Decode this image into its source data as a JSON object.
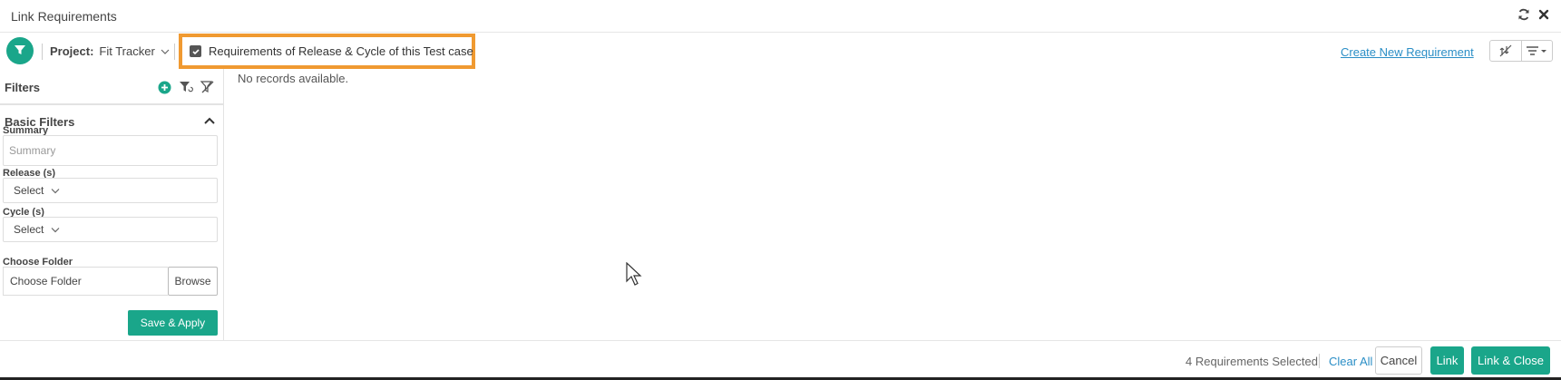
{
  "window": {
    "title": "Link Requirements",
    "refresh_icon": "refresh-icon",
    "close_icon": "close-icon"
  },
  "toolbar": {
    "filter_icon": "filter-icon",
    "project_label": "Project:",
    "project_value": "Fit Tracker",
    "req_checkbox_label": "Requirements of Release & Cycle of this Test case",
    "req_checkbox_checked": true,
    "create_link": "Create New Requirement",
    "highlight_color": "#f09a31"
  },
  "sidebar": {
    "title": "Filters",
    "section_title": "Basic Filters",
    "summary_label": "Summary",
    "summary_placeholder": "Summary",
    "release_label": "Release (s)",
    "release_value": "Select",
    "cycle_label": "Cycle (s)",
    "cycle_value": "Select",
    "folder_label": "Choose Folder",
    "folder_value": "Choose Folder",
    "browse_label": "Browse",
    "save_apply_label": "Save & Apply"
  },
  "main": {
    "empty_message": "No records available."
  },
  "footer": {
    "selected_count": "4 Requirements Selected",
    "clear_all": "Clear All",
    "cancel": "Cancel",
    "link": "Link",
    "link_close": "Link & Close"
  },
  "colors": {
    "accent": "#1aa68a",
    "link": "#2a8ec6"
  }
}
